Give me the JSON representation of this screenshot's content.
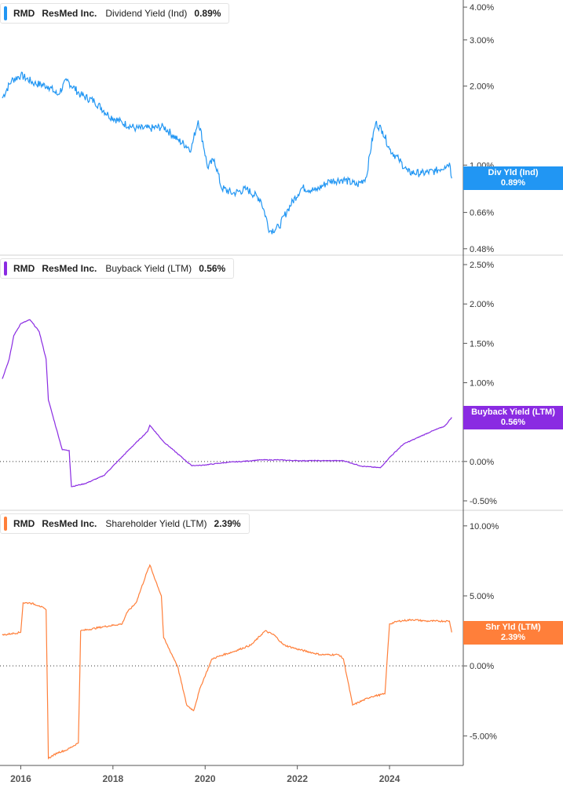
{
  "colors": {
    "dividend": "#2196F3",
    "buyback": "#8A2BE2",
    "shareholder": "#FF7F3A",
    "axis": "#555555",
    "grid": "#d0d0d0"
  },
  "x_axis": {
    "ticks": [
      "2016",
      "2018",
      "2020",
      "2022",
      "2024"
    ]
  },
  "panels": [
    {
      "ticker": "RMD",
      "company": "ResMed Inc.",
      "metric": "Dividend Yield (Ind)",
      "last_value": "0.89%",
      "flag_title": "Div Yld (Ind)",
      "flag_value": "0.89%"
    },
    {
      "ticker": "RMD",
      "company": "ResMed Inc.",
      "metric": "Buyback Yield (LTM)",
      "last_value": "0.56%",
      "flag_title": "Buyback Yield (LTM)",
      "flag_value": "0.56%"
    },
    {
      "ticker": "RMD",
      "company": "ResMed Inc.",
      "metric": "Shareholder Yield (LTM)",
      "last_value": "2.39%",
      "flag_title": "Shr Yld (LTM)",
      "flag_value": "2.39%"
    }
  ],
  "chart_data": [
    {
      "type": "line",
      "title": "",
      "y_scale": "log",
      "ylim": [
        0.46,
        4.2
      ],
      "y_ticks": [
        0.48,
        0.66,
        1.0,
        2.0,
        3.0,
        4.0
      ],
      "y_tick_labels": [
        "0.48%",
        "0.66%",
        "1.00%",
        "2.00%",
        "3.00%",
        "4.00%"
      ],
      "xlim": [
        2015.55,
        2025.6
      ],
      "series": [
        {
          "name": "Dividend Yield (Ind)",
          "x": [
            2015.6,
            2015.8,
            2016.0,
            2016.3,
            2016.6,
            2016.8,
            2017.0,
            2017.3,
            2017.6,
            2017.9,
            2018.2,
            2018.5,
            2018.8,
            2019.1,
            2019.4,
            2019.7,
            2019.85,
            2020.05,
            2020.2,
            2020.35,
            2020.6,
            2020.9,
            2021.2,
            2021.4,
            2021.6,
            2021.8,
            2022.1,
            2022.4,
            2022.7,
            2023.0,
            2023.3,
            2023.5,
            2023.7,
            2023.85,
            2024.0,
            2024.2,
            2024.4,
            2024.7,
            2025.0,
            2025.2,
            2025.3,
            2025.35
          ],
          "values": [
            1.8,
            2.1,
            2.2,
            2.05,
            2.0,
            1.85,
            2.1,
            1.85,
            1.75,
            1.55,
            1.45,
            1.38,
            1.38,
            1.4,
            1.25,
            1.15,
            1.48,
            0.98,
            1.05,
            0.82,
            0.78,
            0.81,
            0.74,
            0.56,
            0.58,
            0.68,
            0.82,
            0.8,
            0.87,
            0.88,
            0.84,
            0.9,
            1.45,
            1.35,
            1.15,
            1.05,
            0.94,
            0.93,
            0.95,
            0.99,
            1.02,
            0.89
          ]
        }
      ]
    },
    {
      "type": "line",
      "title": "",
      "ylim": [
        -0.6,
        2.6
      ],
      "y_ticks": [
        -0.5,
        0,
        0.5,
        1.0,
        1.5,
        2.0,
        2.5
      ],
      "y_tick_labels": [
        "-0.50%",
        "0.00%",
        "0.50%",
        "1.00%",
        "1.50%",
        "2.00%",
        "2.50%"
      ],
      "xlim": [
        2015.55,
        2025.6
      ],
      "series": [
        {
          "name": "Buyback Yield (LTM)",
          "x": [
            2015.6,
            2015.75,
            2015.85,
            2016.0,
            2016.2,
            2016.4,
            2016.55,
            2016.6,
            2016.9,
            2017.05,
            2017.1,
            2017.4,
            2017.8,
            2018.1,
            2018.4,
            2018.75,
            2018.8,
            2019.1,
            2019.4,
            2019.7,
            2019.9,
            2020.2,
            2020.5,
            2020.8,
            2021.2,
            2021.6,
            2022.0,
            2022.5,
            2023.0,
            2023.4,
            2023.8,
            2024.0,
            2024.3,
            2024.6,
            2024.9,
            2025.2,
            2025.35
          ],
          "values": [
            1.05,
            1.3,
            1.6,
            1.75,
            1.8,
            1.65,
            1.3,
            0.78,
            0.15,
            0.14,
            -0.32,
            -0.28,
            -0.18,
            0.0,
            0.18,
            0.38,
            0.46,
            0.25,
            0.1,
            -0.05,
            -0.05,
            -0.03,
            -0.01,
            0.0,
            0.02,
            0.02,
            0.01,
            0.01,
            0.01,
            -0.06,
            -0.08,
            0.05,
            0.22,
            0.3,
            0.38,
            0.45,
            0.56
          ]
        }
      ]
    },
    {
      "type": "line",
      "title": "",
      "ylim": [
        -7.0,
        11.0
      ],
      "y_ticks": [
        -5.0,
        0,
        5.0,
        10.0
      ],
      "y_tick_labels": [
        "-5.00%",
        "0.00%",
        "5.00%",
        "10.00%"
      ],
      "xlim": [
        2015.55,
        2025.6
      ],
      "series": [
        {
          "name": "Shareholder Yield (LTM)",
          "x": [
            2015.6,
            2015.8,
            2016.0,
            2016.05,
            2016.2,
            2016.4,
            2016.55,
            2016.6,
            2016.8,
            2017.0,
            2017.25,
            2017.3,
            2017.8,
            2018.2,
            2018.3,
            2018.5,
            2018.75,
            2018.8,
            2019.05,
            2019.1,
            2019.4,
            2019.6,
            2019.75,
            2019.9,
            2020.15,
            2020.4,
            2020.6,
            2021.0,
            2021.3,
            2021.5,
            2021.7,
            2022.0,
            2022.5,
            2022.9,
            2023.0,
            2023.2,
            2023.6,
            2023.9,
            2024.0,
            2024.2,
            2024.5,
            2024.8,
            2025.0,
            2025.3,
            2025.35
          ],
          "values": [
            2.2,
            2.3,
            2.4,
            4.5,
            4.5,
            4.3,
            4.0,
            -6.6,
            -6.2,
            -6.0,
            -5.5,
            2.5,
            2.8,
            3.0,
            3.8,
            4.5,
            6.8,
            7.2,
            5.0,
            2.0,
            0.0,
            -2.8,
            -3.2,
            -1.5,
            0.5,
            0.8,
            1.0,
            1.5,
            2.5,
            2.2,
            1.5,
            1.2,
            0.8,
            0.8,
            0.5,
            -2.8,
            -2.2,
            -2.0,
            3.0,
            3.2,
            3.3,
            3.2,
            3.2,
            3.2,
            2.39
          ]
        }
      ]
    }
  ]
}
